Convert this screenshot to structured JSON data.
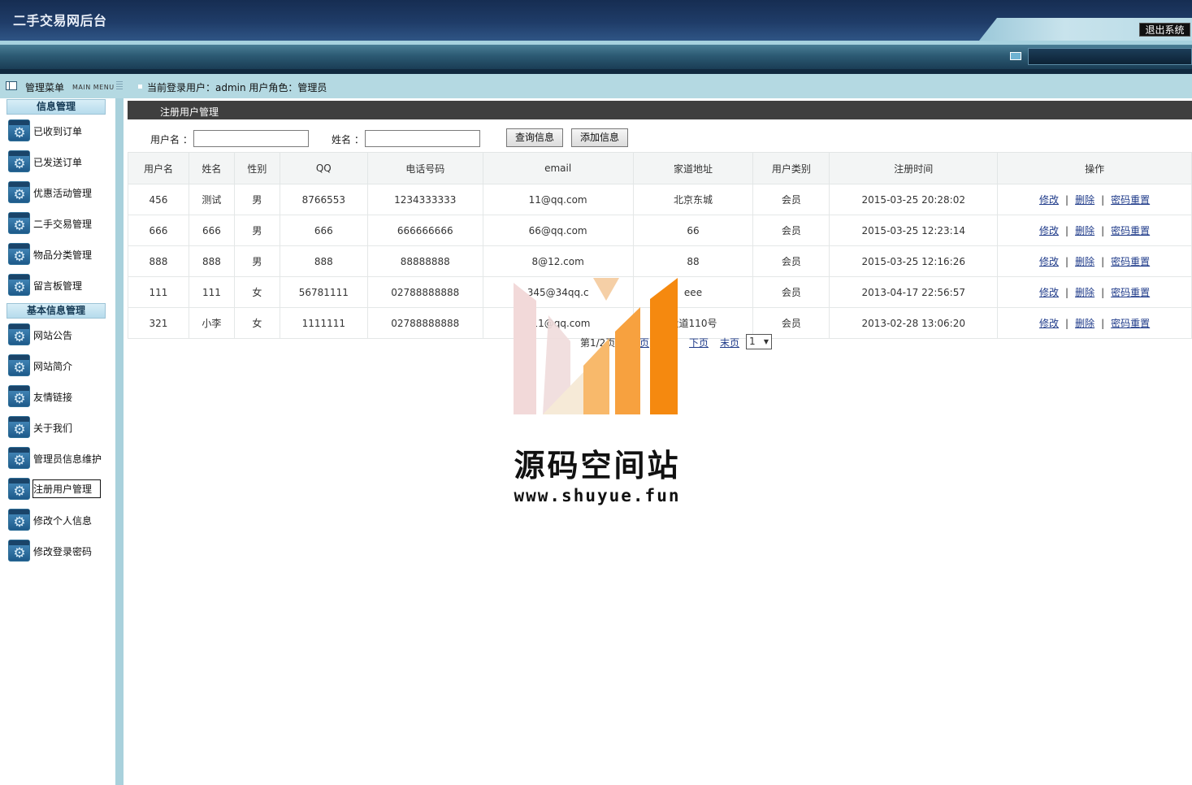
{
  "header": {
    "title": "二手交易网后台",
    "logout_label": "退出系统"
  },
  "subheader": {
    "menu_title": "管理菜单",
    "menu_title_en": "MAIN MENU",
    "user_info": "当前登录用户：admin  用户角色：管理员"
  },
  "sidebar": {
    "sections": [
      {
        "title": "信息管理",
        "items": [
          "已收到订单",
          "已发送订单",
          "优惠活动管理",
          "二手交易管理",
          "物品分类管理",
          "留言板管理"
        ]
      },
      {
        "title": "基本信息管理",
        "items": [
          "网站公告",
          "网站简介",
          "友情链接",
          "关于我们",
          "管理员信息维护",
          "注册用户管理",
          "修改个人信息",
          "修改登录密码"
        ]
      }
    ],
    "active_item": "注册用户管理",
    "item_icon": "gear-icon"
  },
  "main": {
    "panel_title": "注册用户管理",
    "search": {
      "username_label": "用户名 ：",
      "username_value": "",
      "name_label": "姓名 ：",
      "name_value": "",
      "query_button": "查询信息",
      "add_button": "添加信息"
    },
    "table": {
      "columns": [
        "用户名",
        "姓名",
        "性别",
        "QQ",
        "电话号码",
        "email",
        "家道地址",
        "用户类别",
        "注册时间",
        "操作"
      ],
      "rows": [
        [
          "456",
          "测试",
          "男",
          "8766553",
          "1234333333",
          "11@qq.com",
          "北京东城",
          "会员",
          "2015-03-25 20:28:02"
        ],
        [
          "666",
          "666",
          "男",
          "666",
          "666666666",
          "66@qq.com",
          "66",
          "会员",
          "2015-03-25 12:23:14"
        ],
        [
          "888",
          "888",
          "男",
          "888",
          "88888888",
          "8@12.com",
          "88",
          "会员",
          "2015-03-25 12:16:26"
        ],
        [
          "111",
          "111",
          "女",
          "56781111",
          "02788888888",
          "345@34qq.c",
          "eee",
          "会员",
          "2013-04-17 22:56:57"
        ],
        [
          "321",
          "小李",
          "女",
          "1111111",
          "02788888888",
          "111@qq.com",
          "大道110号",
          "会员",
          "2013-02-28 13:06:20"
        ]
      ],
      "actions": [
        "修改",
        "删除",
        "密码重置"
      ],
      "action_separator": "|"
    },
    "pager": {
      "page_info": "第1/2页",
      "prev_fragment": "页",
      "next": "下页",
      "last": "末页",
      "selected_page": "1"
    }
  },
  "watermark": {
    "title": "源码空间站",
    "url": "www.shuyue.fun"
  },
  "colors": {
    "header_dark": "#1f3c68",
    "subbar": "#b4d9e2",
    "panel_title_bg": "#3f3f3f",
    "link": "#1f3b8a",
    "watermark_orange": "#f5890f"
  }
}
